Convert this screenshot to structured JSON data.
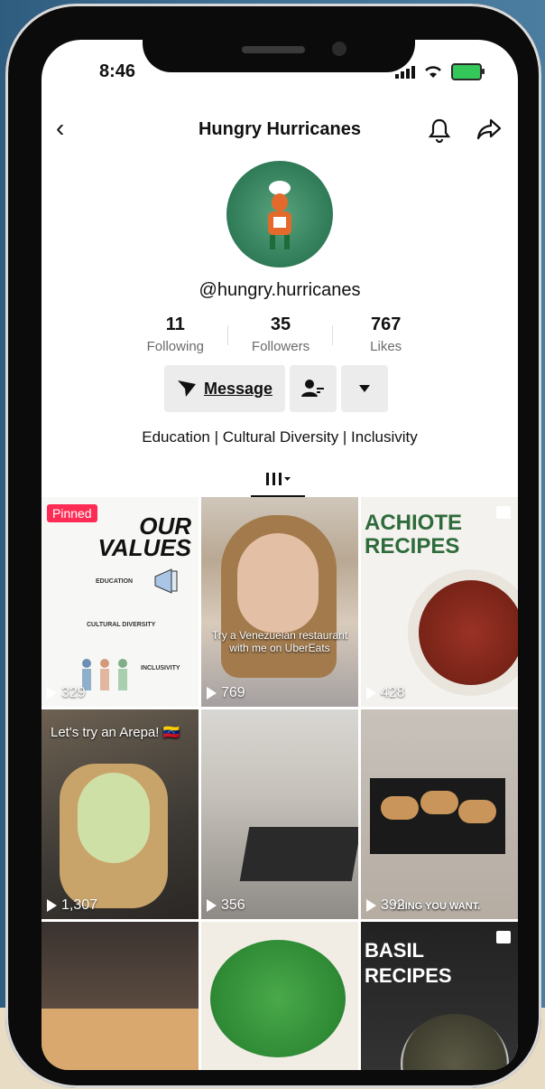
{
  "status_bar": {
    "time": "8:46"
  },
  "profile": {
    "title": "Hungry Hurricanes",
    "handle": "@hungry.hurricanes",
    "stats": [
      {
        "value": "11",
        "label": "Following"
      },
      {
        "value": "35",
        "label": "Followers"
      },
      {
        "value": "767",
        "label": "Likes"
      }
    ],
    "message_label": "Message",
    "bio": "Education | Cultural Diversity | Inclusivity"
  },
  "videos": [
    {
      "views": "329",
      "pinned_label": "Pinned",
      "overlay_title": "OUR VALUES",
      "sections": [
        "EDUCATION",
        "CULTURAL DIVERSITY",
        "INCLUSIVITY"
      ]
    },
    {
      "views": "769",
      "caption": "Try a Venezuelan restaurant with me on UberEats"
    },
    {
      "views": "428",
      "overlay_title": "ACHIOTE RECIPES"
    },
    {
      "views": "1,307",
      "caption": "Let's try an Arepa! 🇻🇪"
    },
    {
      "views": "356"
    },
    {
      "views": "392",
      "caption": "THING YOU WANT."
    },
    {
      "views": ""
    },
    {
      "views": ""
    },
    {
      "views": "",
      "overlay_title": "BASIL RECIPES"
    }
  ],
  "colors": {
    "accent_pinned": "#fe2c55",
    "button_bg": "#ececec",
    "battery": "#34c759"
  }
}
